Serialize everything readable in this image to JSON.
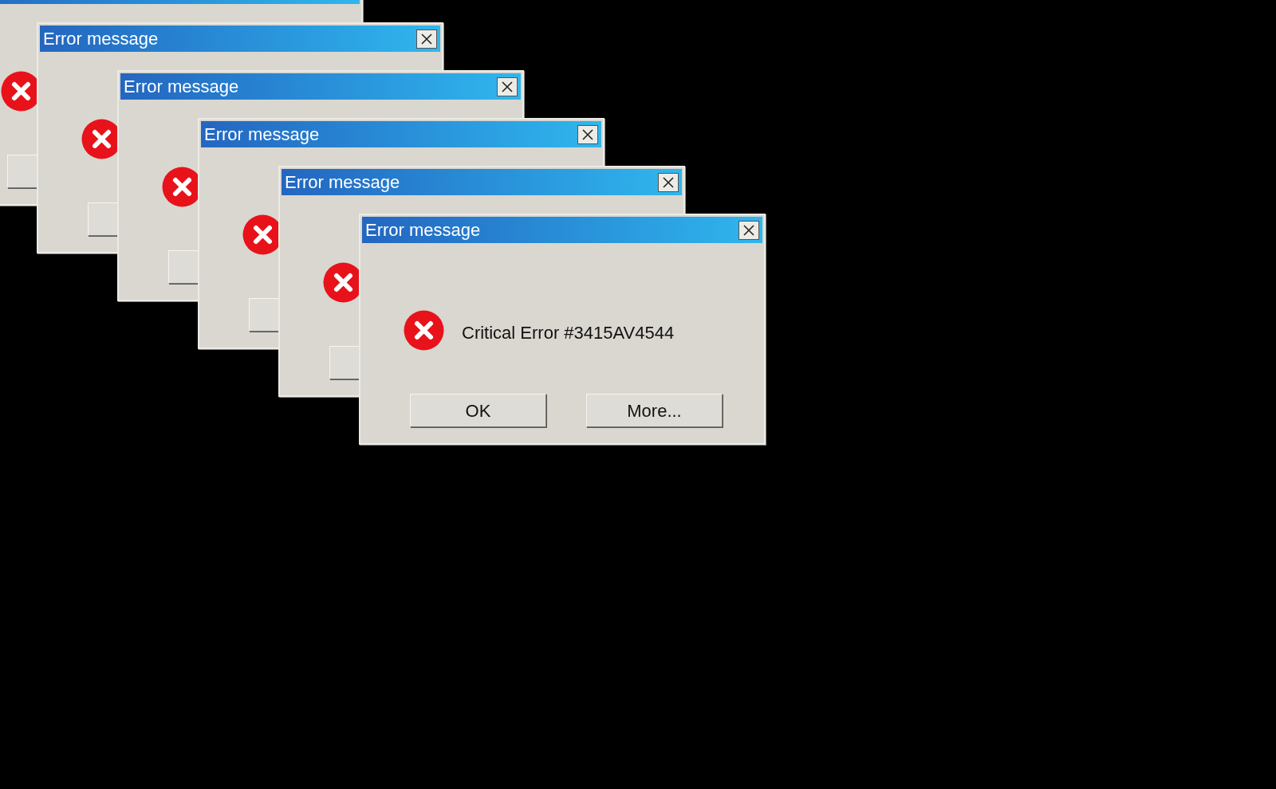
{
  "windows": [
    {
      "kind": "covered"
    },
    {
      "kind": "covered",
      "title": "Error message"
    },
    {
      "kind": "covered",
      "title": "Error message"
    },
    {
      "kind": "covered",
      "title": "Error message"
    },
    {
      "kind": "covered",
      "title": "Error message"
    },
    {
      "kind": "front",
      "title": "Error message",
      "message": "Critical Error #3415AV4544",
      "buttons": [
        "OK",
        "More..."
      ]
    }
  ]
}
